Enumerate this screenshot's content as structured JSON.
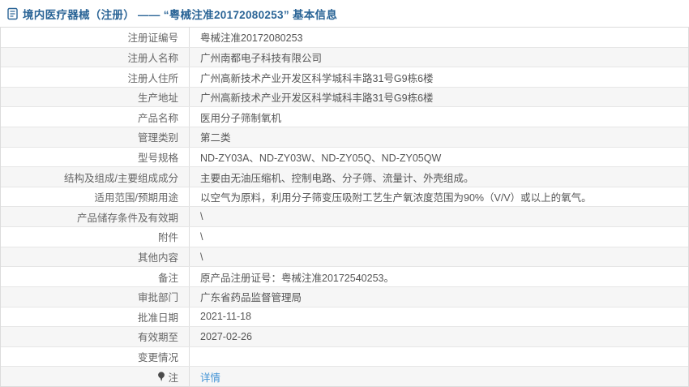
{
  "page": {
    "title": "境内医疗器械（注册） —— “粤械注准20172080253” 基本信息"
  },
  "icons": {
    "header": "document-icon",
    "note": "pin-icon"
  },
  "colors": {
    "title_blue": "#2a6496",
    "link_blue": "#4193d5",
    "row_alt_bg": "#f6f6f6",
    "border": "#dddddd",
    "label_text": "#666666",
    "value_text": "#555555"
  },
  "table": {
    "rows": [
      {
        "label": "注册证编号",
        "value": "粤械注准20172080253"
      },
      {
        "label": "注册人名称",
        "value": "广州南都电子科技有限公司"
      },
      {
        "label": "注册人住所",
        "value": "广州高新技术产业开发区科学城科丰路31号G9栋6楼"
      },
      {
        "label": "生产地址",
        "value": "广州高新技术产业开发区科学城科丰路31号G9栋6楼"
      },
      {
        "label": "产品名称",
        "value": "医用分子筛制氧机"
      },
      {
        "label": "管理类别",
        "value": "第二类"
      },
      {
        "label": "型号规格",
        "value": "ND-ZY03A、ND-ZY03W、ND-ZY05Q、ND-ZY05QW"
      },
      {
        "label": "结构及组成/主要组成成分",
        "value": "主要由无油压缩机、控制电路、分子筛、流量计、外壳组成。"
      },
      {
        "label": "适用范围/预期用途",
        "value": "以空气为原料，利用分子筛变压吸附工艺生产氧浓度范围为90%（V/V）或以上的氧气。"
      },
      {
        "label": "产品储存条件及有效期",
        "value": "\\"
      },
      {
        "label": "附件",
        "value": "\\"
      },
      {
        "label": "其他内容",
        "value": "\\"
      },
      {
        "label": "备注",
        "value": "原产品注册证号：粤械注准20172540253。"
      },
      {
        "label": "审批部门",
        "value": "广东省药品监督管理局"
      },
      {
        "label": "批准日期",
        "value": "2021-11-18"
      },
      {
        "label": "有效期至",
        "value": "2027-02-26"
      },
      {
        "label": "变更情况",
        "value": ""
      },
      {
        "label": "注",
        "value": "详情",
        "link": true,
        "icon": true
      }
    ]
  }
}
